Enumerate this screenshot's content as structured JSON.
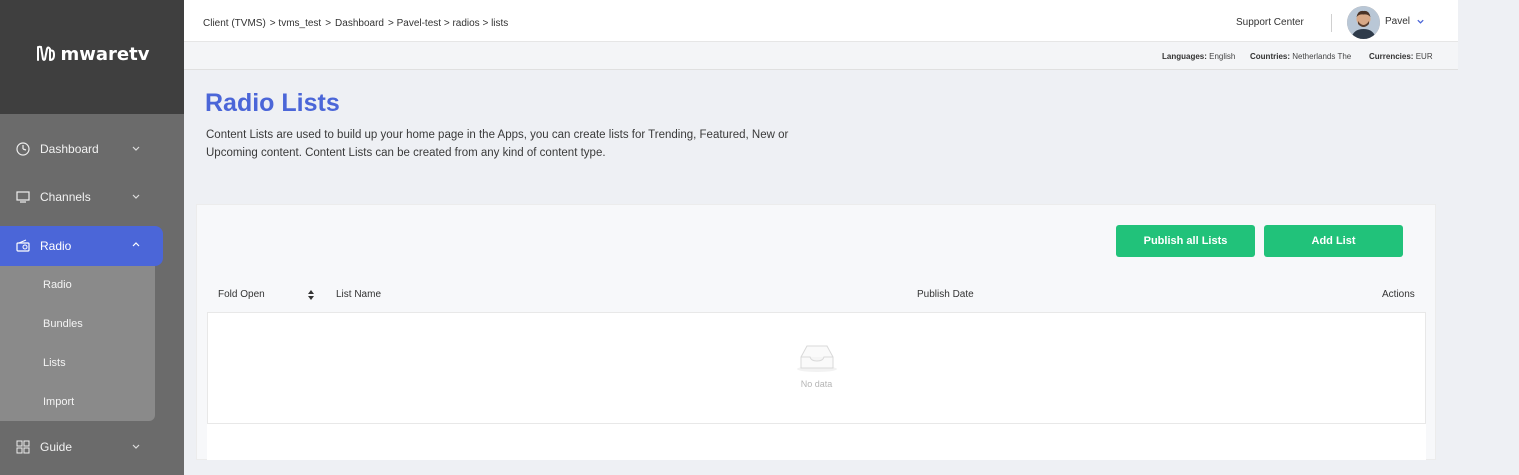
{
  "app": {
    "brand": "mwaretv",
    "brand_mark": "tv"
  },
  "sidebar": {
    "items": [
      {
        "label": "Dashboard",
        "icon": "gauge-icon",
        "expanded": false
      },
      {
        "label": "Channels",
        "icon": "monitor-icon",
        "expanded": false
      },
      {
        "label": "Radio",
        "icon": "radio-icon",
        "expanded": true,
        "active": true
      },
      {
        "label": "Guide",
        "icon": "grid-icon",
        "expanded": false
      }
    ],
    "radio_submenu": [
      "Radio",
      "Bundles",
      "Lists",
      "Import"
    ]
  },
  "header": {
    "breadcrumb": [
      "Client (TVMS)",
      "> tvms_test",
      ">",
      "Dashboard",
      "> Pavel-test > radios > lists"
    ],
    "support": "Support Center",
    "user": "Pavel"
  },
  "subbar": {
    "languages_label": "Languages:",
    "languages_value": "English",
    "countries_label": "Countries:",
    "countries_value": "Netherlands The",
    "currencies_label": "Currencies:",
    "currencies_value": "EUR"
  },
  "page": {
    "title": "Radio Lists",
    "description": "Content Lists are used to build up your home page in the Apps, you can create lists for Trending, Featured, New or Upcoming content. Content Lists can be created from any kind of content type."
  },
  "toolbar": {
    "publish_all": "Publish all Lists",
    "add_list": "Add List"
  },
  "table": {
    "columns": [
      "Fold Open",
      "List Name",
      "Publish Date",
      "Actions"
    ],
    "rows": [],
    "empty_text": "No data"
  },
  "colors": {
    "accent": "#4b66d8",
    "success": "#21c27a",
    "sidebar": "#6b6b6b"
  }
}
